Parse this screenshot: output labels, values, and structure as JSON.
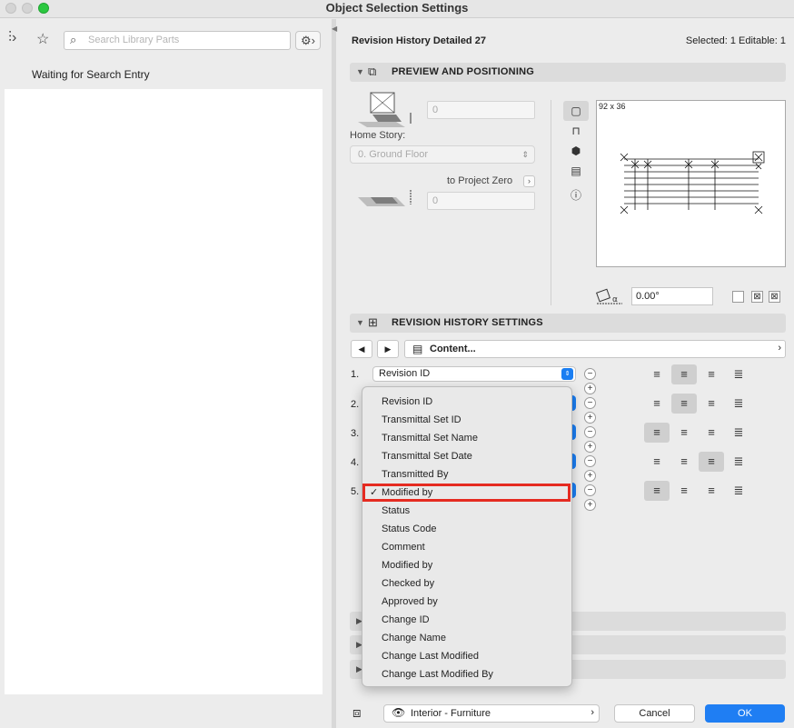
{
  "window": {
    "title": "Object Selection Settings"
  },
  "left_pane": {
    "search_placeholder": "Search Library Parts",
    "status": "Waiting for Search Entry"
  },
  "header": {
    "object_name": "Revision History Detailed 27",
    "selection_info": "Selected: 1 Editable: 1"
  },
  "preview_section": {
    "title": "PREVIEW AND POSITIONING",
    "elevation_value": "0",
    "home_story_label": "Home Story:",
    "home_story_value": "0. Ground Floor",
    "to_project_zero_label": "to Project Zero",
    "project_zero_value": "0",
    "preview_size": "92 x 36",
    "angle_value": "0.00°"
  },
  "revision_section": {
    "title": "REVISION HISTORY SETTINGS",
    "content_label": "Content...",
    "rows": [
      {
        "num": "1.",
        "value": "Revision ID",
        "align_selected": "center"
      },
      {
        "num": "2.",
        "align_selected": "center"
      },
      {
        "num": "3.",
        "align_selected": "left"
      },
      {
        "num": "4.",
        "align_selected": "right"
      },
      {
        "num": "5.",
        "align_selected": "left"
      }
    ]
  },
  "dropdown": {
    "selected": "Modified by",
    "items": [
      "Revision ID",
      "Transmittal Set ID",
      "Transmittal Set Name",
      "Transmittal Set Date",
      "Transmitted By",
      "Modified by",
      "Status",
      "Status Code",
      "Comment",
      "Modified by",
      "Checked by",
      "Approved by",
      "Change ID",
      "Change Name",
      "Change Last Modified",
      "Change Last Modified By"
    ]
  },
  "footer": {
    "layer": "Interior - Furniture",
    "cancel_label": "Cancel",
    "ok_label": "OK"
  },
  "colors": {
    "accent": "#1f7ef3",
    "highlight_border": "#e52b21"
  }
}
